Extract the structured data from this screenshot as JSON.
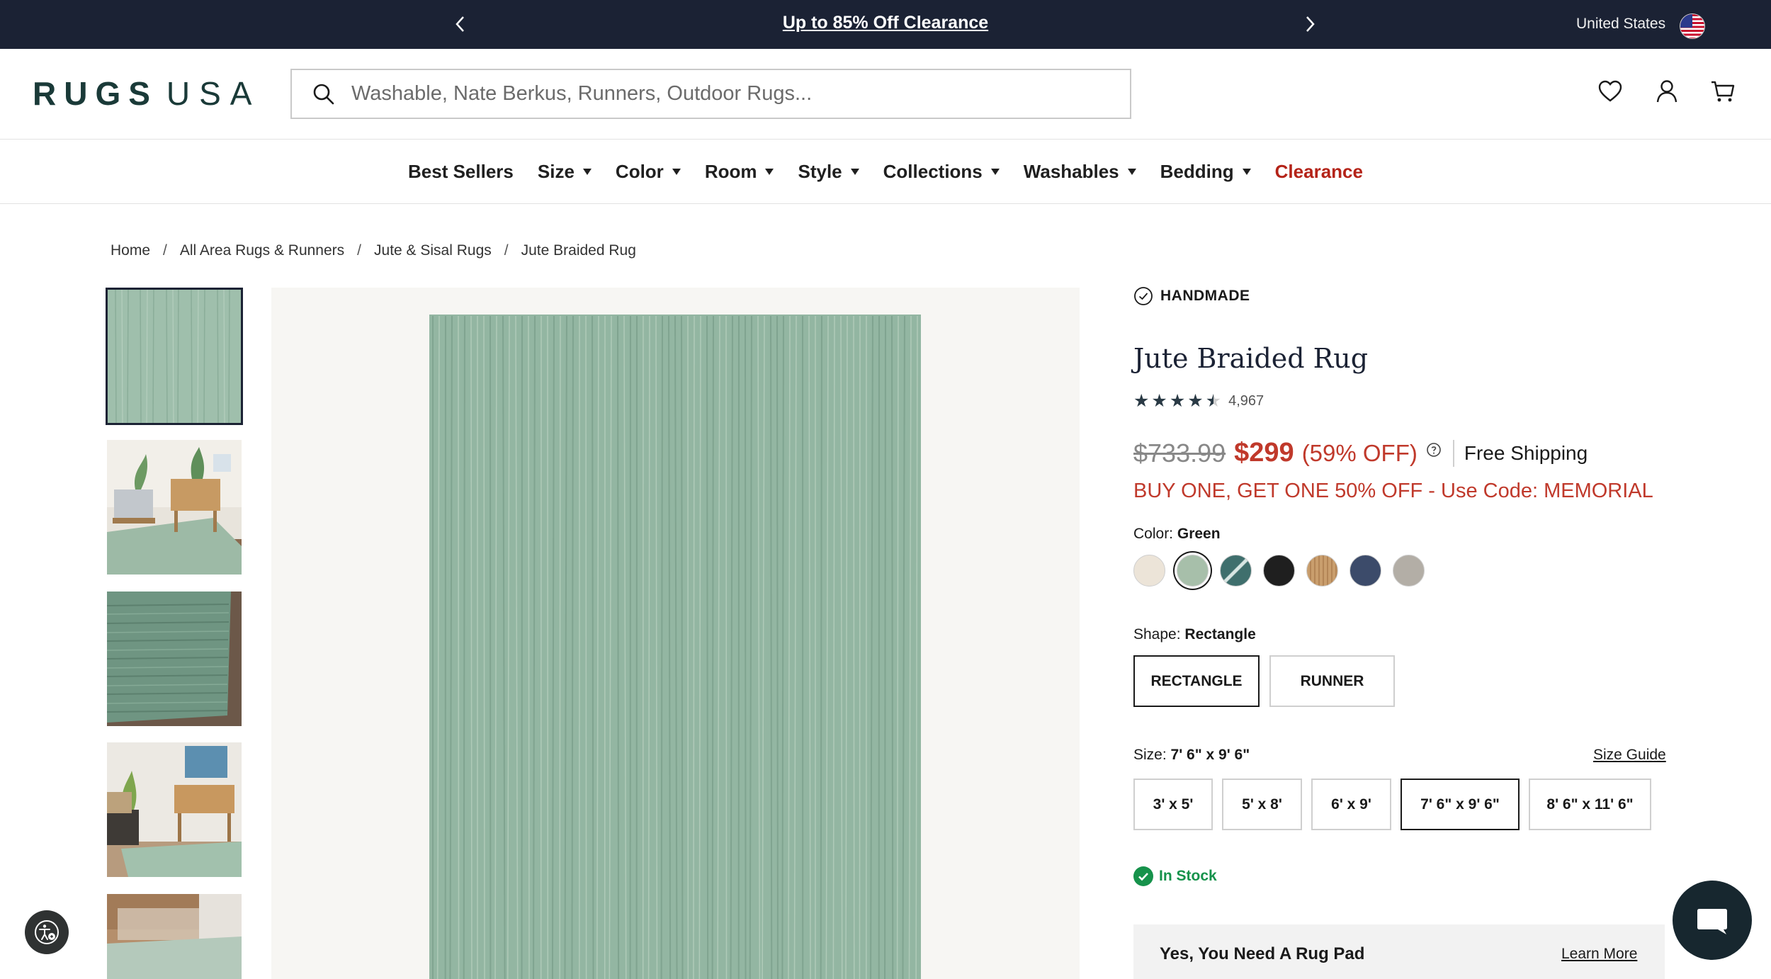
{
  "promo_bar": {
    "message": "Up to 85% Off Clearance",
    "country": "United States"
  },
  "header": {
    "logo_primary": "RUGS",
    "logo_secondary": "USA",
    "search_placeholder": "Washable, Nate Berkus, Runners, Outdoor Rugs..."
  },
  "nav": {
    "items": [
      {
        "label": "Best Sellers",
        "dropdown": false
      },
      {
        "label": "Size",
        "dropdown": true
      },
      {
        "label": "Color",
        "dropdown": true
      },
      {
        "label": "Room",
        "dropdown": true
      },
      {
        "label": "Style",
        "dropdown": true
      },
      {
        "label": "Collections",
        "dropdown": true
      },
      {
        "label": "Washables",
        "dropdown": true
      },
      {
        "label": "Bedding",
        "dropdown": true
      },
      {
        "label": "Clearance",
        "dropdown": false
      }
    ]
  },
  "breadcrumb": [
    "Home",
    "All Area Rugs & Runners",
    "Jute & Sisal Rugs",
    "Jute Braided Rug"
  ],
  "product": {
    "badge": "HANDMADE",
    "title": "Jute Braided Rug",
    "rating": 4.5,
    "review_count": "4,967",
    "original_price": "$733.99",
    "sale_price": "$299",
    "discount": "(59% OFF)",
    "shipping": "Free Shipping",
    "promo_code_text": "BUY ONE, GET ONE 50% OFF - Use Code: MEMORIAL",
    "color_label": "Color:",
    "color_value": "Green",
    "swatch_colors": [
      "#ece4d8",
      "#a7bfaa",
      "#3f6f6d",
      "#1f1f1f",
      "#c99e6d",
      "#3c4b6a",
      "#b3aea6"
    ],
    "selected_swatch": 1,
    "shape_label": "Shape:",
    "shape_value": "Rectangle",
    "shapes": [
      "RECTANGLE",
      "RUNNER"
    ],
    "size_label": "Size:",
    "size_value": "7' 6\" x 9' 6\"",
    "size_guide": "Size Guide",
    "sizes": [
      "3' x 5'",
      "5' x 8'",
      "6' x 9'",
      "7' 6\" x 9' 6\"",
      "8' 6\" x 11' 6\""
    ],
    "stock_status": "In Stock",
    "rug_pad_title": "Yes, You Need A Rug Pad",
    "rug_pad_link": "Learn More"
  },
  "colors": {
    "promo_bg": "#1b2234",
    "sale_red": "#c0392b",
    "clearance_red": "#b42318",
    "stock_green": "#16924b",
    "rug_green": "#8fb49f"
  }
}
